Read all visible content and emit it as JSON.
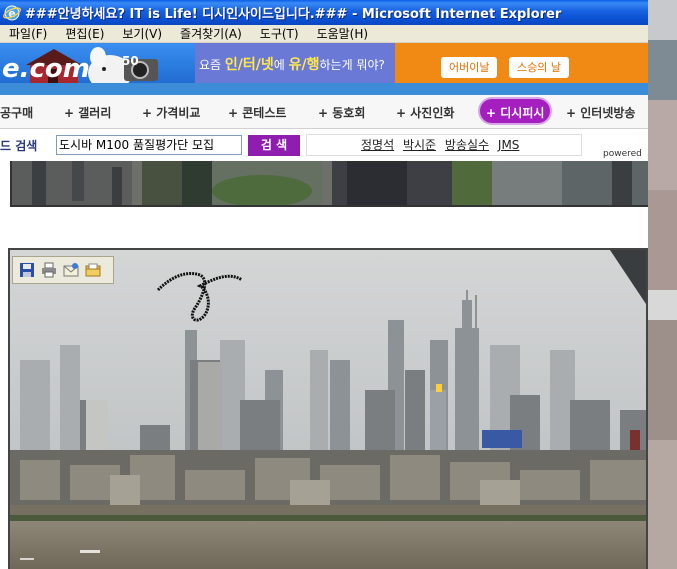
{
  "window": {
    "title": "###안녕하세요? IT is Life! 디시인사이드입니다.### - Microsoft Internet Explorer"
  },
  "menu": {
    "items": [
      "파일(F)",
      "편집(E)",
      "보기(V)",
      "즐겨찾기(A)",
      "도구(T)",
      "도움말(H)"
    ]
  },
  "banner": {
    "logo_text": "e.com",
    "ad_text_prefix": "요즘 ",
    "ad_text_bold1": "인/터/넷",
    "ad_text_mid": "에 ",
    "ad_text_bold2": "유/행",
    "ad_text_suffix": "하는게 뭐야?",
    "btn1": "어버이날",
    "btn2": "스승의 날"
  },
  "nav": {
    "items": [
      "공구매",
      "+ 갤러리",
      "+ 가격비교",
      "+ 콘테스트",
      "+ 동호회",
      "+ 사진인화",
      "+ 디시피시",
      "+ 인터넷방송"
    ],
    "active_index": 6
  },
  "search": {
    "label": "드 검색",
    "input_value": "도시바 M100 품질평가단 모집",
    "button": "검 색",
    "keywords": [
      "정명석",
      "박시준",
      "방송실수",
      "JMS"
    ],
    "powered": "powered"
  },
  "photo_toolbar": {
    "icons": [
      "save-icon",
      "print-icon",
      "mail-icon",
      "open-folder-icon"
    ]
  },
  "colors": {
    "titlebar": "#0b4fd0",
    "menubar": "#ece9d8",
    "nav_active": "#a41ec0",
    "search_button": "#8e1db0",
    "ad_orange": "#f08a14",
    "ad_purple": "#6b79d6"
  }
}
